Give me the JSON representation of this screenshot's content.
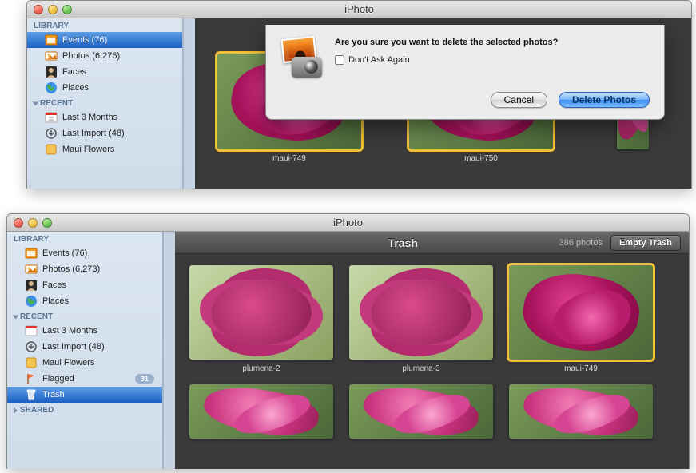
{
  "app_title": "iPhoto",
  "win1": {
    "sidebar": {
      "sections": {
        "library": "Library",
        "recent": "Recent"
      },
      "library_items": [
        {
          "label": "Events (76)",
          "icon": "events"
        },
        {
          "label": "Photos (6,276)",
          "icon": "photos"
        },
        {
          "label": "Faces",
          "icon": "faces"
        },
        {
          "label": "Places",
          "icon": "places"
        }
      ],
      "recent_items": [
        {
          "label": "Last 3 Months",
          "icon": "calendar"
        },
        {
          "label": "Last Import (48)",
          "icon": "import"
        },
        {
          "label": "Maui Flowers",
          "icon": "album"
        }
      ],
      "selected": 0
    },
    "photos": [
      {
        "caption": "maui-749"
      },
      {
        "caption": "maui-750"
      }
    ],
    "dialog": {
      "question": "Are you sure you want to delete the selected photos?",
      "checkbox_label": "Don't Ask Again",
      "cancel": "Cancel",
      "confirm": "Delete Photos"
    }
  },
  "win2": {
    "sidebar": {
      "sections": {
        "library": "Library",
        "recent": "Recent",
        "shared": "Shared"
      },
      "library_items": [
        {
          "label": "Events (76)",
          "icon": "events"
        },
        {
          "label": "Photos (6,273)",
          "icon": "photos"
        },
        {
          "label": "Faces",
          "icon": "faces"
        },
        {
          "label": "Places",
          "icon": "places"
        }
      ],
      "recent_items": [
        {
          "label": "Last 3 Months",
          "icon": "calendar"
        },
        {
          "label": "Last Import (48)",
          "icon": "import"
        },
        {
          "label": "Maui Flowers",
          "icon": "album"
        },
        {
          "label": "Flagged",
          "icon": "flag",
          "badge": "31"
        },
        {
          "label": "Trash",
          "icon": "trash"
        }
      ],
      "selected_recent": 4
    },
    "header": {
      "title": "Trash",
      "count": "386 photos",
      "empty_button": "Empty Trash"
    },
    "thumbs_row1": [
      {
        "caption": "plumeria-2"
      },
      {
        "caption": "plumeria-3"
      },
      {
        "caption": "maui-749"
      }
    ]
  }
}
